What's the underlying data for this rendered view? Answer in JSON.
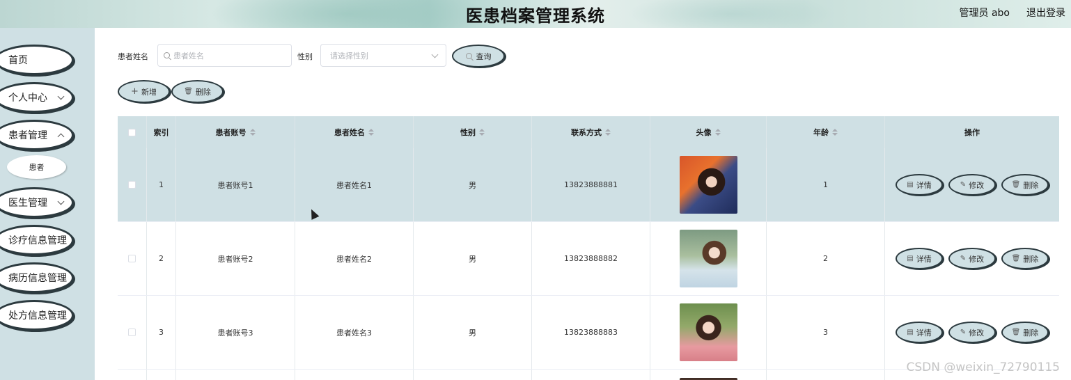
{
  "header": {
    "title": "医患档案管理系统",
    "user_label": "管理员 abo",
    "logout_label": "退出登录"
  },
  "sidebar": {
    "items": [
      {
        "label": "首页",
        "expandable": false
      },
      {
        "label": "个人中心",
        "expandable": true
      },
      {
        "label": "患者管理",
        "expandable": true
      },
      {
        "label": "医生管理",
        "expandable": true
      },
      {
        "label": "诊疗信息管理",
        "expandable": false
      },
      {
        "label": "病历信息管理",
        "expandable": false
      },
      {
        "label": "处方信息管理",
        "expandable": false
      }
    ],
    "sub_item": "患者"
  },
  "filters": {
    "name_label": "患者姓名",
    "name_placeholder": "患者姓名",
    "gender_label": "性别",
    "gender_placeholder": "请选择性别",
    "query_button": "查询"
  },
  "actions": {
    "add_button": "新增",
    "delete_button": "删除"
  },
  "table": {
    "headers": {
      "index": "索引",
      "account": "患者账号",
      "name": "患者姓名",
      "gender": "性别",
      "phone": "联系方式",
      "avatar": "头像",
      "age": "年龄",
      "ops": "操作"
    },
    "op_labels": {
      "detail": "详情",
      "edit": "修改",
      "delete": "删除"
    },
    "rows": [
      {
        "index": "1",
        "account": "患者账号1",
        "name": "患者姓名1",
        "gender": "男",
        "phone": "13823888881",
        "age": "1"
      },
      {
        "index": "2",
        "account": "患者账号2",
        "name": "患者姓名2",
        "gender": "男",
        "phone": "13823888882",
        "age": "2"
      },
      {
        "index": "3",
        "account": "患者账号3",
        "name": "患者姓名3",
        "gender": "男",
        "phone": "13823888883",
        "age": "3"
      }
    ]
  },
  "watermark": "CSDN @weixin_72790115",
  "colors": {
    "accent": "#cfe0e4",
    "border": "#2c3a3f"
  }
}
